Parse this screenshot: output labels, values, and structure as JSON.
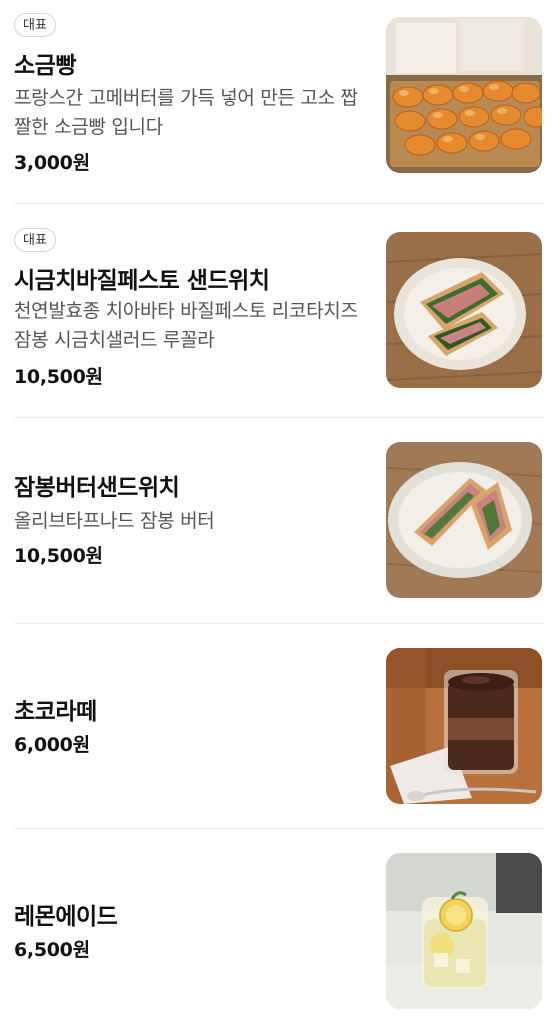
{
  "menu": [
    {
      "badge": "대표",
      "name": "소금빵",
      "description": "프랑스간 고메버터를 가득 넣어 만든 고소 짭짤한 소금빵 입니다",
      "price": "3,000원",
      "image_icon": "salt-bread-photo"
    },
    {
      "badge": "대표",
      "name": "시금치바질페스토 샌드위치",
      "description": "천연발효종 치아바타 바질페스토 리코타치즈 잠봉 시금치샐러드 루꼴라",
      "price": "10,500원",
      "image_icon": "spinach-basil-sandwich-photo"
    },
    {
      "name": "잠봉버터샌드위치",
      "description": "올리브타프나드 잠봉 버터",
      "price": "10,500원",
      "image_icon": "jambon-butter-sandwich-photo"
    },
    {
      "name": "초코라떼",
      "price": "6,000원",
      "image_icon": "choco-latte-photo"
    },
    {
      "name": "레몬에이드",
      "price": "6,500원",
      "image_icon": "lemonade-photo"
    }
  ]
}
